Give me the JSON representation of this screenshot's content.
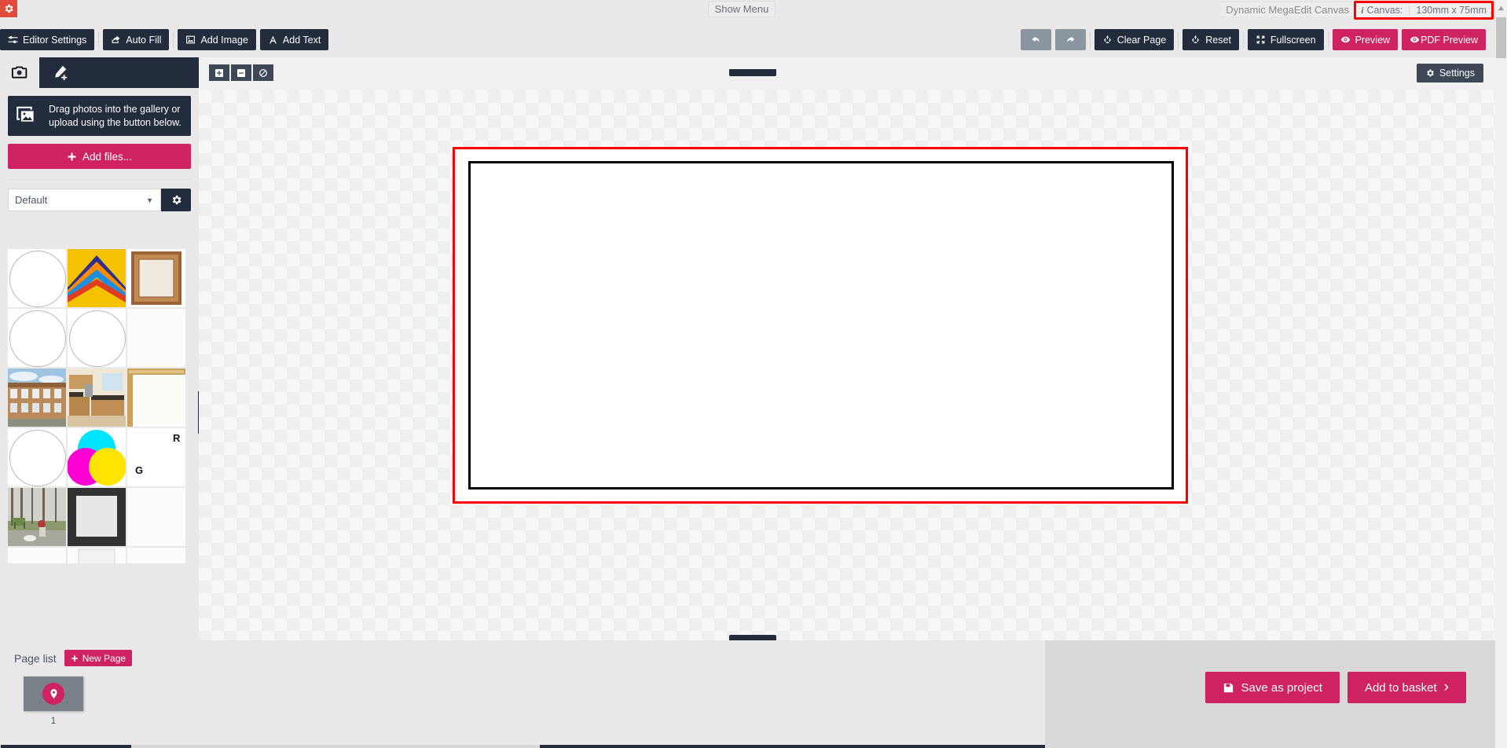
{
  "top": {
    "corner_icon": "gear-icon",
    "show_menu_label": "Show Menu",
    "canvas_name": "Dynamic MegaEdit Canvas",
    "canvas_info_icon": "info-icon",
    "canvas_label": "Canvas:",
    "canvas_size": "130mm x 75mm",
    "highlight_color": "#ff0000"
  },
  "toolbar": {
    "left_buttons": [
      {
        "label": "Editor Settings",
        "icon": "sliders-icon",
        "style": "dark"
      },
      {
        "label": "Auto Fill",
        "icon": "share-icon",
        "style": "dark"
      },
      {
        "label": "Add Image",
        "icon": "image-icon",
        "style": "dark"
      },
      {
        "label": "Add Text",
        "icon": "text-a-icon",
        "style": "dark"
      }
    ],
    "right_buttons": [
      {
        "label": "",
        "icon": "undo-icon",
        "style": "grey"
      },
      {
        "label": "",
        "icon": "redo-icon",
        "style": "grey"
      },
      {
        "label": "Clear Page",
        "icon": "recycle-icon",
        "style": "dark"
      },
      {
        "label": "Reset",
        "icon": "recycle-icon",
        "style": "dark"
      },
      {
        "label": "Fullscreen",
        "icon": "expand-arrows-icon",
        "style": "dark"
      },
      {
        "label": "Preview",
        "icon": "eye-icon",
        "style": "pink"
      },
      {
        "label": "PDF Preview",
        "icon": "eye-icon",
        "style": "pink"
      }
    ]
  },
  "sidebar": {
    "tabs": [
      {
        "name": "photos-tab",
        "icon": "camera-icon",
        "active": true
      },
      {
        "name": "design-tab",
        "icon": "pen-plus-icon",
        "active": false
      }
    ],
    "dropzone": {
      "icon": "photos-stack-icon",
      "text": "Drag photos into the gallery or upload using the button below."
    },
    "add_files_label": "Add files...",
    "add_files_icon": "plus-icon",
    "category_select": {
      "value": "Default",
      "caret_icon": "chevron-down-icon"
    },
    "category_settings_icon": "gear-icon",
    "gallery": [
      {
        "name": "thumb-circle-1",
        "kind": "circle"
      },
      {
        "name": "thumb-chevron-frames",
        "kind": "chevrons"
      },
      {
        "name": "thumb-wood-frame",
        "kind": "woodframe"
      },
      {
        "name": "thumb-circle-2",
        "kind": "circle"
      },
      {
        "name": "thumb-circle-3",
        "kind": "circle"
      },
      {
        "name": "thumb-blank-1",
        "kind": "blank"
      },
      {
        "name": "thumb-apartment-building",
        "kind": "building"
      },
      {
        "name": "thumb-kitchen-interior",
        "kind": "kitchen"
      },
      {
        "name": "thumb-gold-frame",
        "kind": "goldframe"
      },
      {
        "name": "thumb-circle-4",
        "kind": "circle"
      },
      {
        "name": "thumb-cmyk-venn",
        "kind": "cmyk"
      },
      {
        "name": "thumb-rgb-venn",
        "kind": "rgb"
      },
      {
        "name": "thumb-park-scene",
        "kind": "park"
      },
      {
        "name": "thumb-dark-square-frame",
        "kind": "darkframe"
      },
      {
        "name": "thumb-blank-2",
        "kind": "blank"
      },
      {
        "name": "thumb-blank-3",
        "kind": "blank"
      },
      {
        "name": "thumb-light-frame",
        "kind": "lightframe"
      },
      {
        "name": "thumb-blank-4",
        "kind": "blank"
      }
    ],
    "collapse_handle": "sidebar-collapse-handle",
    "swap_icon": "swap-arrows-icon"
  },
  "editor": {
    "zoom_buttons": [
      {
        "name": "zoom-in-button",
        "icon": "plus-square-icon"
      },
      {
        "name": "zoom-out-button",
        "icon": "minus-square-icon"
      },
      {
        "name": "zoom-reset-button",
        "icon": "ban-icon"
      }
    ],
    "settings_label": "Settings",
    "settings_icon": "gear-icon",
    "page": {
      "selection_border_color": "#ff0000",
      "inner_border_color": "#000000",
      "background_color": "#ffffff"
    }
  },
  "footer": {
    "page_list_label": "Page list",
    "new_page_label": "New Page",
    "new_page_icon": "plus-icon",
    "pages": [
      {
        "number": "1",
        "icon": "map-pin-icon"
      }
    ],
    "save_label": "Save as project",
    "save_icon": "floppy-disk-icon",
    "basket_label": "Add to basket",
    "basket_caret": "›"
  }
}
